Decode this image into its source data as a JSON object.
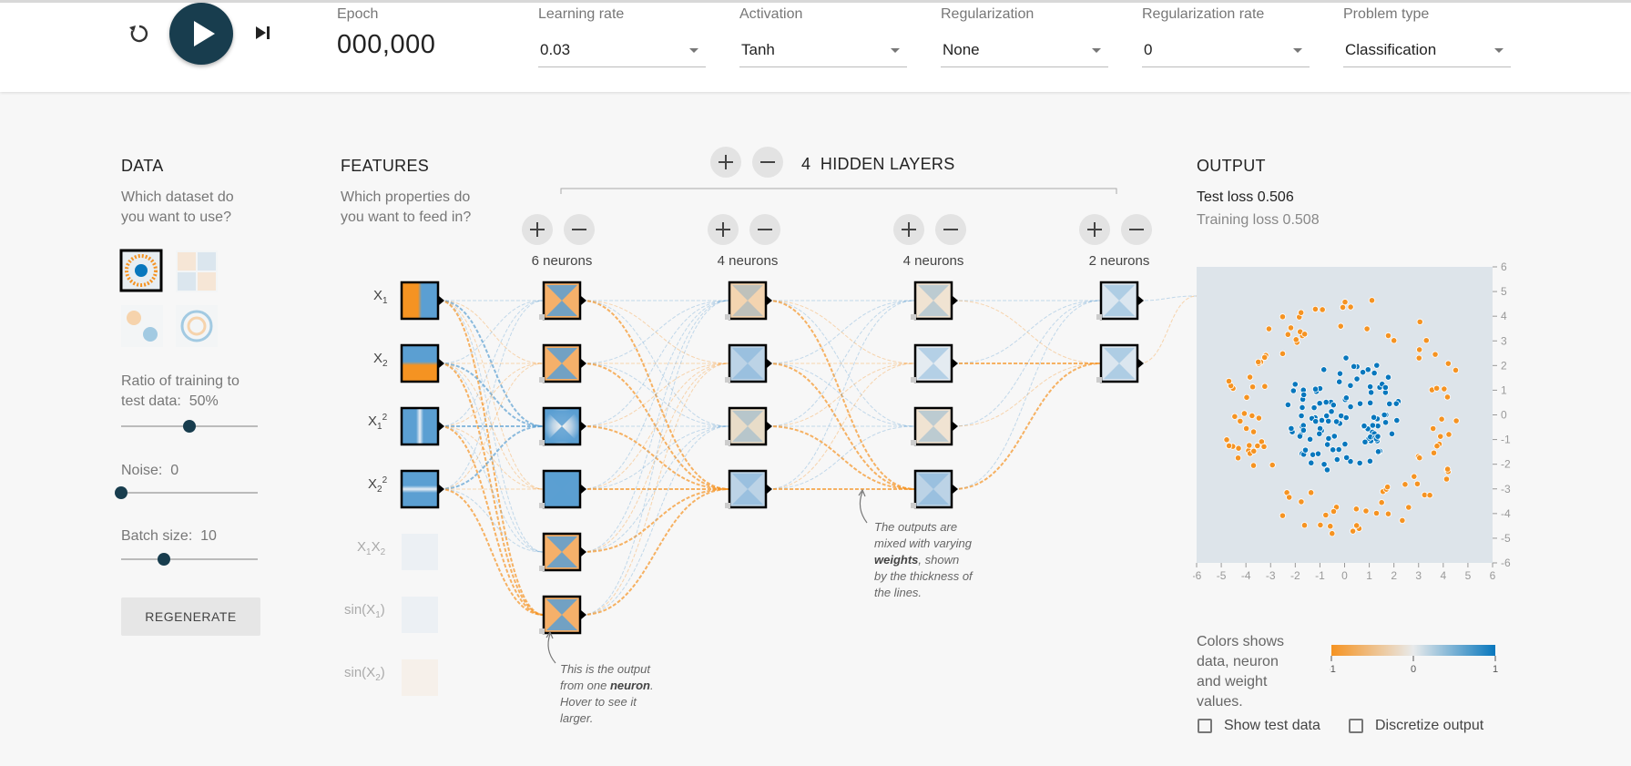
{
  "toolbar": {
    "epoch_label": "Epoch",
    "epoch_value": "000,000",
    "learning_rate": {
      "label": "Learning rate",
      "value": "0.03"
    },
    "activation": {
      "label": "Activation",
      "value": "Tanh"
    },
    "regularization": {
      "label": "Regularization",
      "value": "None"
    },
    "regularization_rate": {
      "label": "Regularization rate",
      "value": "0"
    },
    "problem_type": {
      "label": "Problem type",
      "value": "Classification"
    }
  },
  "data_panel": {
    "title": "DATA",
    "subtitle": "Which dataset do you want to use?",
    "ratio_label": "Ratio of training to test data:",
    "ratio_value": "50%",
    "ratio_fraction": 0.5,
    "noise_label": "Noise:",
    "noise_value": "0",
    "noise_fraction": 0,
    "batch_label": "Batch size:",
    "batch_value": "10",
    "batch_fraction": 0.31,
    "regenerate": "REGENERATE"
  },
  "features_panel": {
    "title": "FEATURES",
    "subtitle": "Which properties do you want to feed in?",
    "features": [
      "X1",
      "X2",
      "X1²",
      "X2²",
      "X1X2",
      "sin(X1)",
      "sin(X2)"
    ]
  },
  "hidden": {
    "count": "4",
    "label": "HIDDEN LAYERS",
    "layers": [
      {
        "neurons_label": "6 neurons"
      },
      {
        "neurons_label": "4 neurons"
      },
      {
        "neurons_label": "4 neurons"
      },
      {
        "neurons_label": "2 neurons"
      }
    ]
  },
  "annotations": {
    "neuron_note": [
      "This is the output",
      "from one",
      "neuron",
      ". Hover to see it",
      "larger."
    ],
    "weights_note": [
      "The outputs are",
      "mixed with varying",
      "weights",
      ", shown",
      "by the thickness of",
      "the lines."
    ]
  },
  "output_panel": {
    "title": "OUTPUT",
    "test_loss": "Test loss 0.506",
    "training_loss": "Training loss 0.508",
    "x_ticks": [
      "-6",
      "-5",
      "-4",
      "-3",
      "-2",
      "-1",
      "0",
      "1",
      "2",
      "3",
      "4",
      "5",
      "6"
    ],
    "y_ticks": [
      "6",
      "5",
      "4",
      "3",
      "2",
      "1",
      "0",
      "-1",
      "-2",
      "-3",
      "-4",
      "-5",
      "-6"
    ],
    "legend_text": "Colors shows data, neuron and weight values.",
    "legend_ticks": [
      "-1",
      "0",
      "1"
    ],
    "show_test_data": "Show test data",
    "discretize_output": "Discretize output"
  },
  "colors": {
    "orange": "#f59322",
    "blue": "#0877bd",
    "dark": "#183d4e"
  }
}
